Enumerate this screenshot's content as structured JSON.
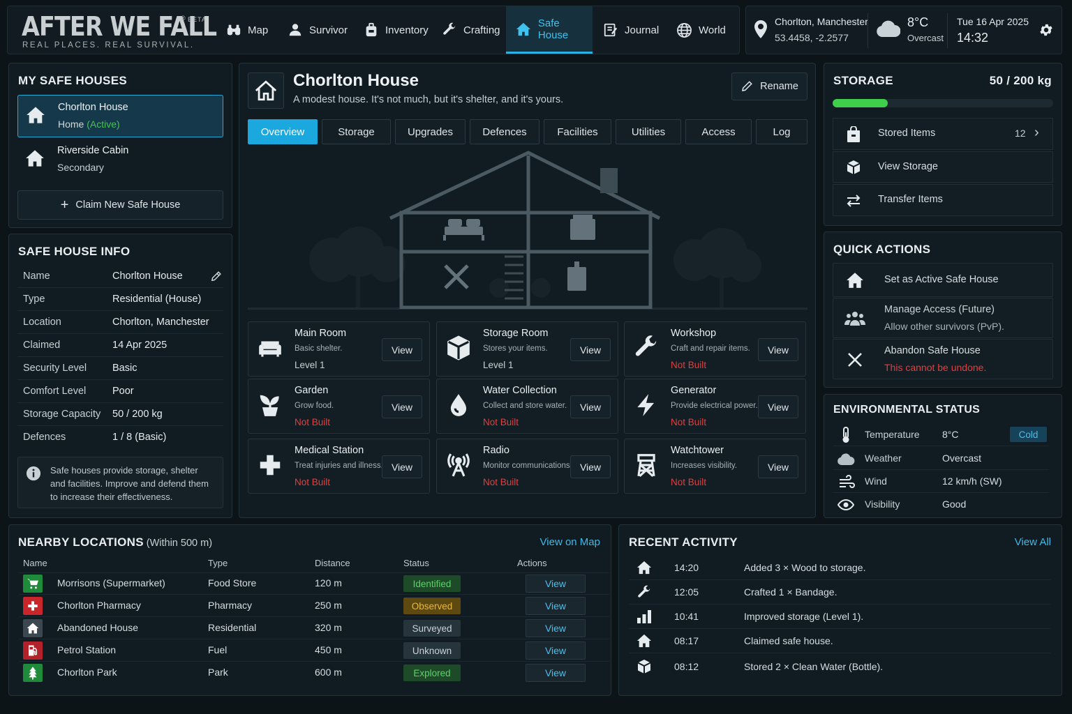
{
  "app": {
    "logo": "AFTER WE FALL",
    "logo_mark": "®",
    "beta": "BETA",
    "tagline": "REAL PLACES. REAL SURVIVAL."
  },
  "nav": [
    {
      "label": "Map",
      "icon": "binoculars-icon"
    },
    {
      "label": "Survivor",
      "icon": "person-icon"
    },
    {
      "label": "Inventory",
      "icon": "backpack-icon"
    },
    {
      "label": "Crafting",
      "icon": "wrench-icon"
    },
    {
      "label": "Safe House",
      "icon": "house-icon",
      "active": true
    },
    {
      "label": "Journal",
      "icon": "journal-icon"
    },
    {
      "label": "World",
      "icon": "globe-icon"
    }
  ],
  "location": {
    "name": "Chorlton, Manchester",
    "coords": "53.4458, -2.2577"
  },
  "weather": {
    "temp": "8°C",
    "condition": "Overcast"
  },
  "datetime": {
    "date": "Tue 16 Apr 2025",
    "time": "14:32"
  },
  "my_safe_houses": {
    "title": "MY SAFE HOUSES",
    "items": [
      {
        "name": "Chorlton House",
        "sub": "Home",
        "sub_tag": "(Active)"
      },
      {
        "name": "Riverside Cabin",
        "sub": "Secondary"
      }
    ],
    "claim_label": "Claim New Safe House"
  },
  "safe_house_info": {
    "title": "SAFE HOUSE INFO",
    "rows": [
      {
        "k": "Name",
        "v": "Chorlton House"
      },
      {
        "k": "Type",
        "v": "Residential (House)"
      },
      {
        "k": "Location",
        "v": "Chorlton, Manchester"
      },
      {
        "k": "Claimed",
        "v": "14 Apr 2025"
      },
      {
        "k": "Security Level",
        "v": "Basic"
      },
      {
        "k": "Comfort Level",
        "v": "Poor"
      },
      {
        "k": "Storage Capacity",
        "v": "50 / 200 kg"
      },
      {
        "k": "Defences",
        "v": "1 / 8 (Basic)"
      }
    ],
    "note": "Safe houses provide storage, shelter and facilities. Improve and defend them to increase their effectiveness."
  },
  "house": {
    "title": "Chorlton House",
    "description": "A modest house. It's not much, but it's shelter, and it's yours.",
    "rename_label": "Rename",
    "tabs": [
      "Overview",
      "Storage",
      "Upgrades",
      "Defences",
      "Facilities",
      "Utilities",
      "Access",
      "Log"
    ],
    "active_tab": "Overview",
    "facilities": [
      {
        "name": "Main Room",
        "desc": "Basic shelter.",
        "status": "Level 1",
        "built": true,
        "icon": "sofa-icon"
      },
      {
        "name": "Storage Room",
        "desc": "Stores your items.",
        "status": "Level 1",
        "built": true,
        "icon": "box-icon"
      },
      {
        "name": "Workshop",
        "desc": "Craft and repair items.",
        "status": "Not Built",
        "built": false,
        "icon": "wrench-icon"
      },
      {
        "name": "Garden",
        "desc": "Grow food.",
        "status": "Not Built",
        "built": false,
        "icon": "plant-icon"
      },
      {
        "name": "Water Collection",
        "desc": "Collect and store water.",
        "status": "Not Built",
        "built": false,
        "icon": "water-drop-icon"
      },
      {
        "name": "Generator",
        "desc": "Provide electrical power.",
        "status": "Not Built",
        "built": false,
        "icon": "lightning-icon"
      },
      {
        "name": "Medical Station",
        "desc": "Treat injuries and illness.",
        "status": "Not Built",
        "built": false,
        "icon": "medical-cross-icon"
      },
      {
        "name": "Radio",
        "desc": "Monitor communications.",
        "status": "Not Built",
        "built": false,
        "icon": "radio-tower-icon"
      },
      {
        "name": "Watchtower",
        "desc": "Increases visibility.",
        "status": "Not Built",
        "built": false,
        "icon": "watchtower-icon"
      }
    ],
    "view_label": "View"
  },
  "storage": {
    "title": "STORAGE",
    "used": "50 / 200 kg",
    "fill_fraction": 0.25,
    "items": [
      {
        "label": "Stored Items",
        "count": "12",
        "icon": "bag-icon"
      },
      {
        "label": "View Storage",
        "icon": "box-icon"
      },
      {
        "label": "Transfer Items",
        "icon": "transfer-icon"
      }
    ]
  },
  "quick_actions": {
    "title": "QUICK ACTIONS",
    "items": [
      {
        "label": "Set as Active Safe House"
      },
      {
        "label": "Manage Access (Future)",
        "sub": "Allow other survivors (PvP)."
      },
      {
        "label": "Abandon Safe House",
        "sub": "This cannot be undone."
      }
    ]
  },
  "environment": {
    "title": "ENVIRONMENTAL STATUS",
    "rows": [
      {
        "k": "Temperature",
        "v": "8°C",
        "badge": "Cold"
      },
      {
        "k": "Weather",
        "v": "Overcast"
      },
      {
        "k": "Wind",
        "v": "12 km/h (SW)"
      },
      {
        "k": "Visibility",
        "v": "Good"
      }
    ]
  },
  "nearby": {
    "title": "NEARBY LOCATIONS",
    "subtitle": "(Within 500 m)",
    "map_link": "View on Map",
    "headers": [
      "Name",
      "Type",
      "Distance",
      "Status",
      "Actions"
    ],
    "rows": [
      {
        "name": "Morrisons (Supermarket)",
        "type": "Food Store",
        "dist": "120 m",
        "status": "Identified",
        "icon": "cart-icon",
        "icolor": "#1e8a3a"
      },
      {
        "name": "Chorlton Pharmacy",
        "type": "Pharmacy",
        "dist": "250 m",
        "status": "Observed",
        "icon": "pharmacy-cross-icon",
        "icolor": "#c9262c"
      },
      {
        "name": "Abandoned House",
        "type": "Residential",
        "dist": "320 m",
        "status": "Surveyed",
        "icon": "house-icon",
        "icolor": "#3b4850"
      },
      {
        "name": "Petrol Station",
        "type": "Fuel",
        "dist": "450 m",
        "status": "Unknown",
        "icon": "fuel-pump-icon",
        "icolor": "#b3222a"
      },
      {
        "name": "Chorlton Park",
        "type": "Park",
        "dist": "600 m",
        "status": "Explored",
        "icon": "tree-icon",
        "icolor": "#1e8a3a"
      }
    ],
    "action_label": "View"
  },
  "recent_activity": {
    "title": "RECENT ACTIVITY",
    "view_all": "View All",
    "rows": [
      {
        "time": "14:20",
        "text": "Added 3 × Wood to storage.",
        "icon": "house-icon"
      },
      {
        "time": "12:05",
        "text": "Crafted 1 × Bandage.",
        "icon": "wrench-icon"
      },
      {
        "time": "10:41",
        "text": "Improved storage (Level 1).",
        "icon": "bar-chart-icon"
      },
      {
        "time": "08:17",
        "text": "Claimed safe house.",
        "icon": "house-icon"
      },
      {
        "time": "08:12",
        "text": "Stored 2 × Clean Water (Bottle).",
        "icon": "box-icon"
      }
    ]
  },
  "colors": {
    "accent": "#1ba8df",
    "red": "#e43d3d",
    "yellow": "#e8b330",
    "green": "#47c157"
  }
}
